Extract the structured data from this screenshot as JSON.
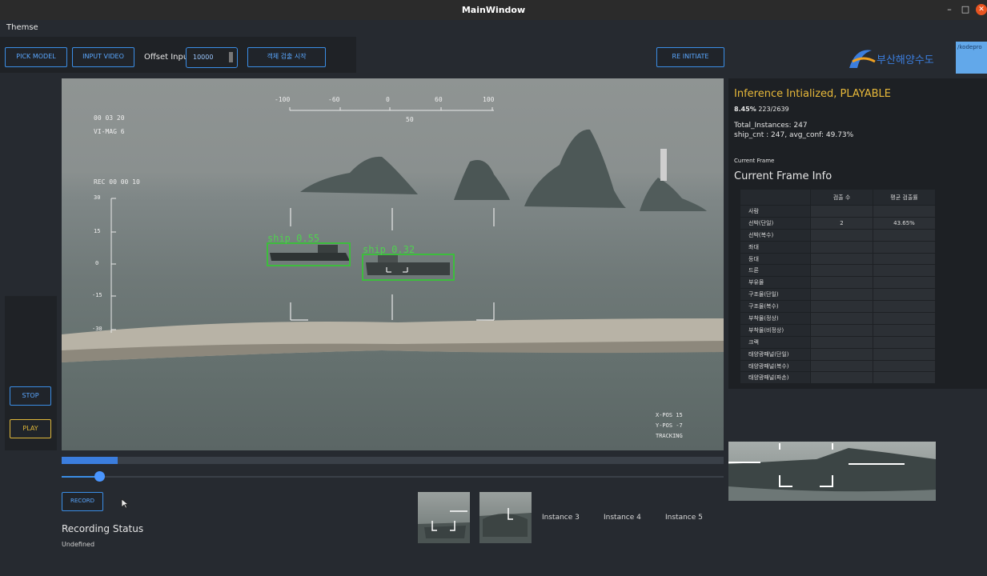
{
  "window": {
    "title": "MainWindow"
  },
  "menu": {
    "themes_label": "Themse"
  },
  "toolbar": {
    "pick_model_label": "PICK MODEL",
    "input_video_label": "INPUT VIDEO",
    "offset_label": "Offset Input",
    "offset_value": "10000",
    "detect_start_label": "객체 검출 시작",
    "reinitiate_label": "RE INITIATE"
  },
  "branding": {
    "logo_text": "부산해양수도",
    "badge_text": "/kodepro"
  },
  "video": {
    "hud_time": "00 03 20",
    "hud_mag": "VI-MAG 6",
    "hud_rec": "REC 00 00 10",
    "top_scale": [
      "-100",
      "-60",
      "0",
      "60",
      "100"
    ],
    "top_scale_value": "50",
    "left_scale": [
      "30",
      "15",
      "0",
      "-15",
      "-30"
    ],
    "bottom_right": [
      "X-POS 15",
      "Y-POS -7",
      "TRACKING"
    ],
    "detections": [
      {
        "label": "ship",
        "score": "0.55"
      },
      {
        "label": "ship",
        "score": "0.32"
      }
    ]
  },
  "controls": {
    "stop_label": "STOP",
    "play_label": "PLAY",
    "record_label": "RECORD"
  },
  "progress": {
    "fraction": 0.0845
  },
  "slider": {
    "fraction": 0.057
  },
  "recording": {
    "title": "Recording Status",
    "value": "Undefined"
  },
  "instances": [
    "Instance 3",
    "Instance 4",
    "Instance 5"
  ],
  "info": {
    "status": "Inference Intialized, PLAYABLE",
    "percent": "8.45%",
    "frames": "223/2639",
    "total_instances": "Total_Instances: 247",
    "ship_summary": "ship_cnt : 247, avg_conf: 49.73%",
    "current_frame_label": "Current Frame",
    "current_frame_info": "Current Frame Info",
    "table_headers": [
      "검출 수",
      "평균 검출률"
    ],
    "table_rows": [
      {
        "label": "사람",
        "count": "",
        "conf": ""
      },
      {
        "label": "선박(단일)",
        "count": "2",
        "conf": "43.65%"
      },
      {
        "label": "선박(복수)",
        "count": "",
        "conf": ""
      },
      {
        "label": "좌대",
        "count": "",
        "conf": ""
      },
      {
        "label": "등대",
        "count": "",
        "conf": ""
      },
      {
        "label": "드론",
        "count": "",
        "conf": ""
      },
      {
        "label": "부유물",
        "count": "",
        "conf": ""
      },
      {
        "label": "구조물(단일)",
        "count": "",
        "conf": ""
      },
      {
        "label": "구조물(복수)",
        "count": "",
        "conf": ""
      },
      {
        "label": "부착물(정상)",
        "count": "",
        "conf": ""
      },
      {
        "label": "부착물(비정상)",
        "count": "",
        "conf": ""
      },
      {
        "label": "크랙",
        "count": "",
        "conf": ""
      },
      {
        "label": "태양광패널(단일)",
        "count": "",
        "conf": ""
      },
      {
        "label": "태양광패널(복수)",
        "count": "",
        "conf": ""
      },
      {
        "label": "태양광패널(파손)",
        "count": "",
        "conf": ""
      }
    ]
  },
  "colors": {
    "accent": "#3b8ee6",
    "gold": "#e0b83a",
    "detection": "#3dbd3d"
  }
}
